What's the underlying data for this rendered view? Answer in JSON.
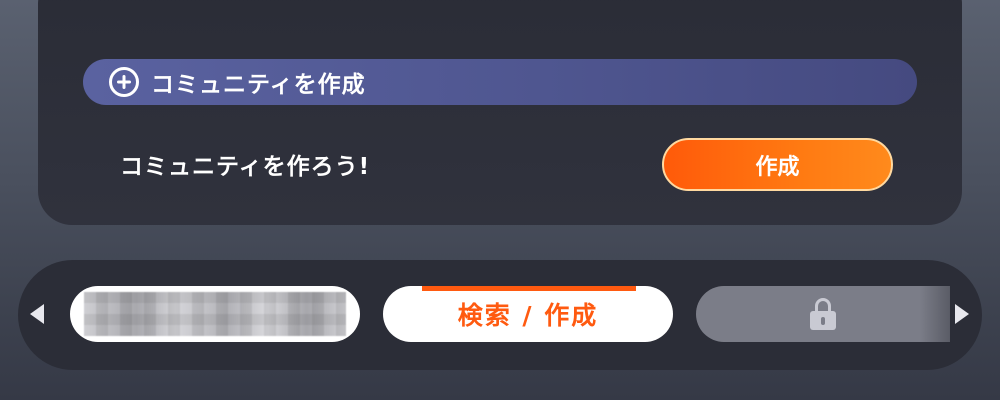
{
  "community": {
    "header_title": "コミュニティを作成",
    "header_icon": "plus-circle-icon",
    "prompt": "コミュニティを作ろう!",
    "create_label": "作成"
  },
  "tabs": {
    "active_label": "検索 / 作成",
    "locked_icon": "lock-icon",
    "accent_color": "#ff5a10"
  }
}
